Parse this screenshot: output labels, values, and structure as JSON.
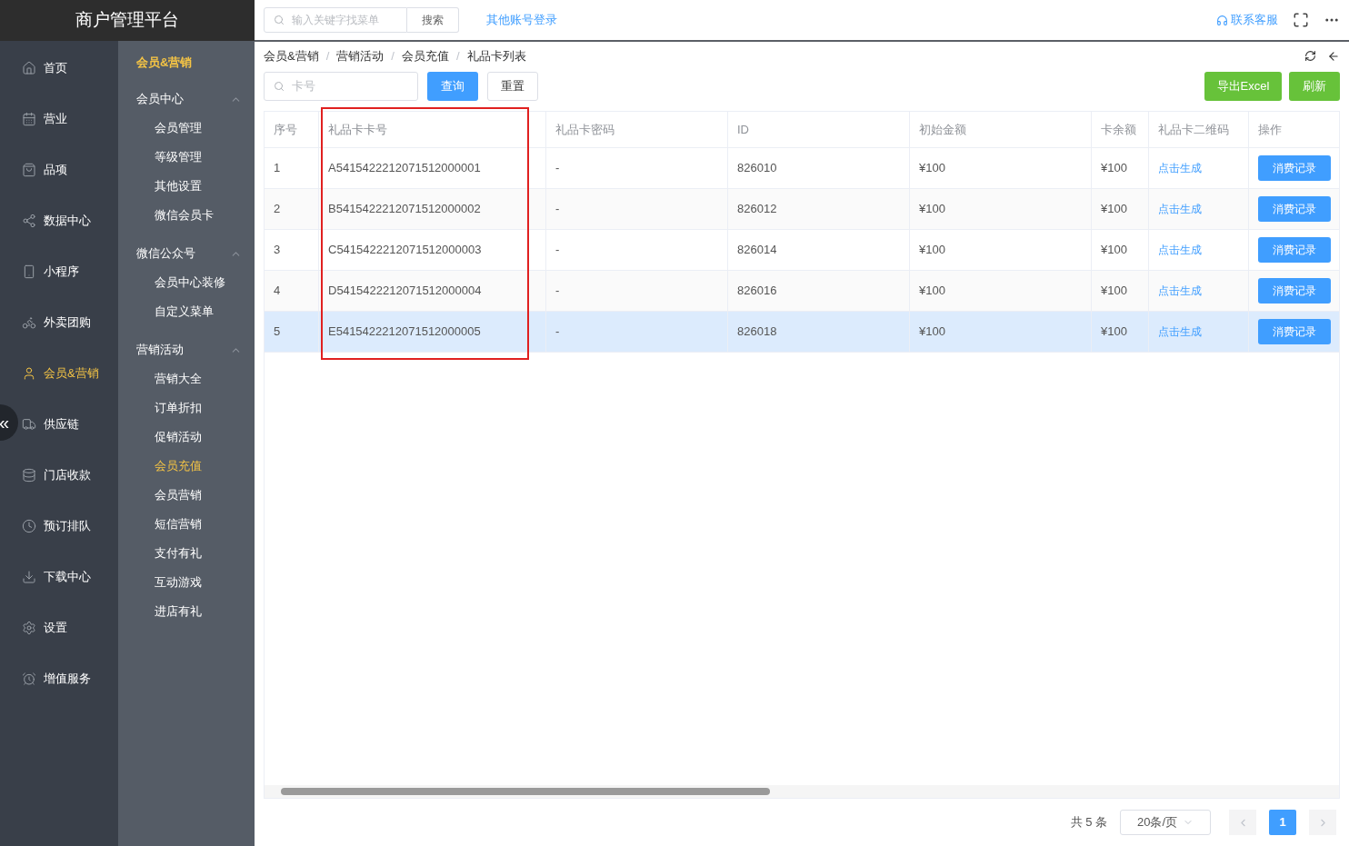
{
  "brand": {
    "title": "商户管理平台"
  },
  "header": {
    "search": {
      "placeholder": "输入关键字找菜单",
      "button": "搜索"
    },
    "other_login": "其他账号登录",
    "support": "联系客服"
  },
  "rail": {
    "items": [
      {
        "label": "首页",
        "selected": false
      },
      {
        "label": "营业",
        "selected": false
      },
      {
        "label": "品项",
        "selected": false
      },
      {
        "label": "数据中心",
        "selected": false
      },
      {
        "label": "小程序",
        "selected": false
      },
      {
        "label": "外卖团购",
        "selected": false
      },
      {
        "label": "会员&营销",
        "selected": true
      },
      {
        "label": "供应链",
        "selected": false
      },
      {
        "label": "门店收款",
        "selected": false
      },
      {
        "label": "预订排队",
        "selected": false
      },
      {
        "label": "下载中心",
        "selected": false
      },
      {
        "label": "设置",
        "selected": false
      },
      {
        "label": "增值服务",
        "selected": false
      }
    ],
    "collapse_button": "«"
  },
  "submenu": {
    "title": "会员&营销",
    "groups": [
      {
        "label": "会员中心",
        "expanded": true,
        "children": [
          {
            "label": "会员管理",
            "selected": false
          },
          {
            "label": "等级管理",
            "selected": false
          },
          {
            "label": "其他设置",
            "selected": false
          },
          {
            "label": "微信会员卡",
            "selected": false
          }
        ]
      },
      {
        "label": "微信公众号",
        "expanded": true,
        "children": [
          {
            "label": "会员中心装修",
            "selected": false
          },
          {
            "label": "自定义菜单",
            "selected": false
          }
        ]
      },
      {
        "label": "营销活动",
        "expanded": true,
        "children": [
          {
            "label": "营销大全",
            "selected": false
          },
          {
            "label": "订单折扣",
            "selected": false
          },
          {
            "label": "促销活动",
            "selected": false
          },
          {
            "label": "会员充值",
            "selected": true
          },
          {
            "label": "会员营销",
            "selected": false
          },
          {
            "label": "短信营销",
            "selected": false
          },
          {
            "label": "支付有礼",
            "selected": false
          },
          {
            "label": "互动游戏",
            "selected": false
          },
          {
            "label": "进店有礼",
            "selected": false
          }
        ]
      }
    ]
  },
  "breadcrumb": [
    {
      "kind": "link",
      "label": "会员&营销"
    },
    {
      "kind": "separator",
      "label": "/"
    },
    {
      "kind": "link",
      "label": "营销活动"
    },
    {
      "kind": "separator",
      "label": "/"
    },
    {
      "kind": "link",
      "label": "会员充值"
    },
    {
      "kind": "separator",
      "label": "/"
    },
    {
      "kind": "current",
      "label": "礼品卡列表"
    }
  ],
  "filter": {
    "placeholder": "卡号",
    "query": "查询",
    "reset": "重置",
    "export": "导出Excel",
    "refresh": "刷新"
  },
  "table": {
    "columns": [
      {
        "label": "序号",
        "highlighted": false
      },
      {
        "label": "礼品卡卡号",
        "highlighted": true
      },
      {
        "label": "礼品卡密码",
        "highlighted": false
      },
      {
        "label": "ID",
        "highlighted": false
      },
      {
        "label": "初始金额",
        "highlighted": false
      },
      {
        "label": "卡余额",
        "highlighted": false
      },
      {
        "label": "礼品卡二维码",
        "highlighted": false
      },
      {
        "label": "操作",
        "highlighted": false
      }
    ],
    "rows": [
      {
        "cells": [
          "1",
          "A5415422212071512000001",
          "-",
          "826010",
          "¥100",
          "¥100"
        ],
        "qr_link": "点击生成",
        "action": "消费记录",
        "selected": false
      },
      {
        "cells": [
          "2",
          "B5415422212071512000002",
          "-",
          "826012",
          "¥100",
          "¥100"
        ],
        "qr_link": "点击生成",
        "action": "消费记录",
        "selected": false
      },
      {
        "cells": [
          "3",
          "C5415422212071512000003",
          "-",
          "826014",
          "¥100",
          "¥100"
        ],
        "qr_link": "点击生成",
        "action": "消费记录",
        "selected": false
      },
      {
        "cells": [
          "4",
          "D5415422212071512000004",
          "-",
          "826016",
          "¥100",
          "¥100"
        ],
        "qr_link": "点击生成",
        "action": "消费记录",
        "selected": false
      },
      {
        "cells": [
          "5",
          "E5415422212071512000005",
          "-",
          "826018",
          "¥100",
          "¥100"
        ],
        "qr_link": "点击生成",
        "action": "消费记录",
        "selected": true
      }
    ]
  },
  "pagination": {
    "total": "共 5 条",
    "page_size": "20条/页",
    "pages": [
      {
        "label": "1",
        "selected": true
      }
    ]
  }
}
